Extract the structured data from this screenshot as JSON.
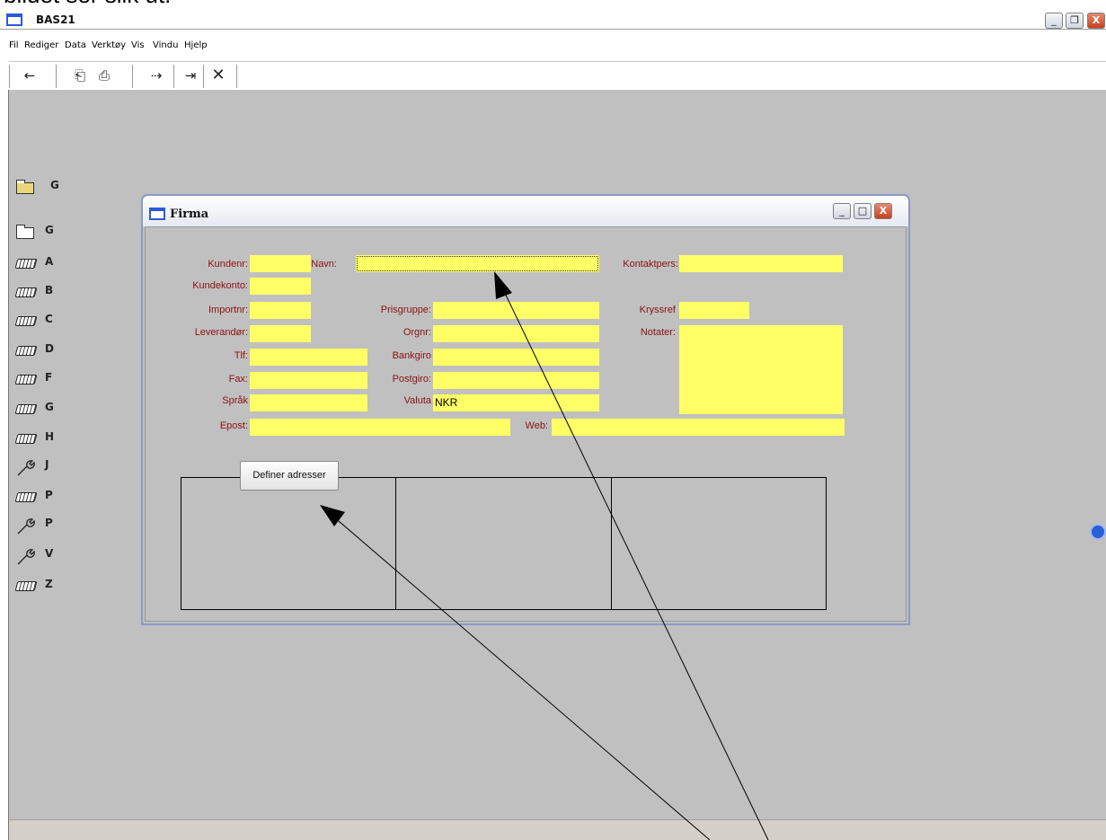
{
  "caption": "bildet ser slik ut:",
  "app": {
    "title": "BAS21",
    "controls": {
      "minimize": "_",
      "restore": "❐",
      "close": "X"
    }
  },
  "menu": [
    "Fil",
    "Rediger",
    "Data",
    "Verktøy",
    "Vis",
    "Vindu",
    "Hjelp"
  ],
  "toolbar": {
    "buttons": [
      {
        "icon": "back-arrow-icon",
        "glyph": "←"
      },
      {
        "icon": "exit-door-icon",
        "glyph": "⎗"
      },
      {
        "icon": "printer-icon",
        "glyph": "⎙"
      },
      {
        "icon": "insert-record-icon",
        "glyph": "⇢"
      },
      {
        "icon": "insert-field-icon",
        "glyph": "⇥"
      },
      {
        "icon": "delete-icon",
        "glyph": "✕"
      }
    ]
  },
  "nav": [
    {
      "icon": "folder-open-icon",
      "label": "G"
    },
    {
      "icon": "folder-icon",
      "label": "G"
    },
    {
      "icon": "keyboard-icon",
      "label": "A"
    },
    {
      "icon": "keyboard-icon",
      "label": "B"
    },
    {
      "icon": "keyboard-icon",
      "label": "C"
    },
    {
      "icon": "keyboard-icon",
      "label": "D"
    },
    {
      "icon": "keyboard-icon",
      "label": "F"
    },
    {
      "icon": "keyboard-icon",
      "label": "G"
    },
    {
      "icon": "keyboard-icon",
      "label": "H"
    },
    {
      "icon": "wrench-icon",
      "label": "J"
    },
    {
      "icon": "keyboard-icon",
      "label": "P"
    },
    {
      "icon": "wrench-icon",
      "label": "P"
    },
    {
      "icon": "wrench-icon",
      "label": "V"
    },
    {
      "icon": "keyboard-icon",
      "label": "Z"
    }
  ],
  "firma": {
    "title": "Firma",
    "labels": {
      "kundenr": "Kundenr:",
      "navn": "Navn:",
      "kontaktpers": "Kontaktpers:",
      "kundekonto": "Kundekonto:",
      "importnr": "Importnr:",
      "prisgruppe": "Prisgruppe:",
      "kryssref": "Kryssref",
      "leverandor": "Leverandør:",
      "orgnr": "Orgnr:",
      "notater": "Notater:",
      "tlf": "Tlf:",
      "bankgiro": "Bankgiro",
      "fax": "Fax:",
      "postgiro": "Postgiro:",
      "sprak": "Språk",
      "valuta": "Valuta",
      "epost": "Epost:",
      "web": "Web:"
    },
    "values": {
      "kundenr": "",
      "navn": "",
      "kontaktpers": "",
      "kundekonto": "",
      "importnr": "",
      "prisgruppe": "",
      "kryssref": "",
      "leverandor": "",
      "orgnr": "",
      "notater": "",
      "tlf": "",
      "bankgiro": "",
      "fax": "",
      "postgiro": "",
      "sprak": "",
      "valuta": "NKR",
      "epost": "",
      "web": ""
    },
    "define_button": "Definer adresser"
  },
  "colors": {
    "field_bg": "#ffff66",
    "label_text": "#8b1111",
    "workspace": "#c0c0c0"
  }
}
